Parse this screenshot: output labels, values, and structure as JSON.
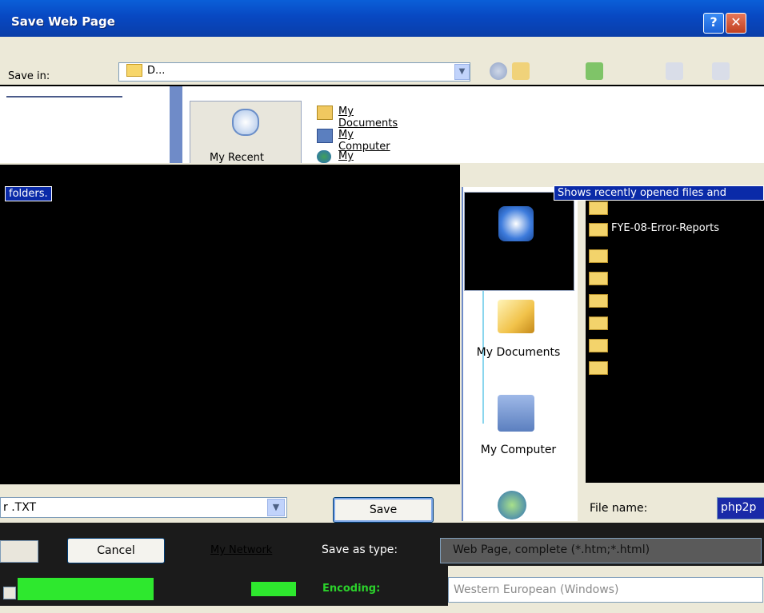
{
  "window": {
    "title": "Save Web Page",
    "help_glyph": "?",
    "close_glyph": "✕"
  },
  "toolbar": {
    "savein_label": "Save in:",
    "savein_value": "D..."
  },
  "upper_places": {
    "recent_label": "My Recent"
  },
  "upper_list": [
    {
      "label": "My Documents",
      "icon": "my-documents-icon"
    },
    {
      "label": "My Computer",
      "icon": "my-computer-icon"
    },
    {
      "label": "My Network Places",
      "icon": "my-network-icon"
    }
  ],
  "tooltips": {
    "left": "folders.",
    "right": "Shows recently opened files and"
  },
  "places": [
    {
      "label": "",
      "icon": "recent-icon"
    },
    {
      "label": "My Documents",
      "icon": "my-documents-icon"
    },
    {
      "label": "My Computer",
      "icon": "my-computer-icon"
    },
    {
      "label": "My Network",
      "icon": "my-network-icon"
    }
  ],
  "folders": [
    {
      "label": "",
      "style": "red"
    },
    {
      "label": "FYE-08-Error-Reports",
      "style": "normal"
    },
    {
      "label": "",
      "style": "red"
    },
    {
      "label": "",
      "style": "red"
    },
    {
      "label": "",
      "style": "red"
    },
    {
      "label": "",
      "style": "red"
    },
    {
      "label": "",
      "style": "red"
    },
    {
      "label": "",
      "style": "red"
    }
  ],
  "form": {
    "filetype_left_value": "r .TXT",
    "save_label": "Save",
    "cancel_label": "Cancel",
    "filename_label": "File name:",
    "filename_value": "php2p",
    "saveas_label": "Save as type:",
    "saveas_value": "Web Page, complete (*.htm;*.html)",
    "encoding_label": "Encoding:",
    "encoding_value": "Western European (Windows)"
  },
  "colors": {
    "titlebar": "#0848c2",
    "tooltip_bg": "#0a2aa8",
    "glitch_green": "#2ee82e"
  }
}
